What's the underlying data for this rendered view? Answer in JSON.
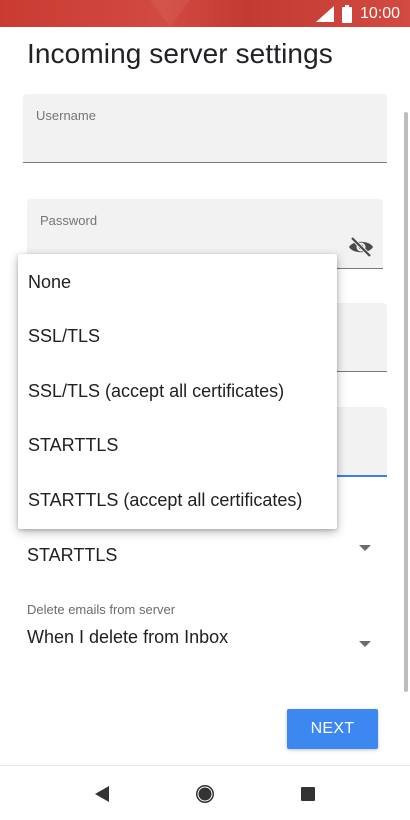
{
  "status_bar": {
    "time": "10:00",
    "icons": [
      "signal-icon",
      "battery-icon"
    ]
  },
  "page": {
    "title": "Incoming server settings"
  },
  "fields": {
    "username": {
      "label": "Username",
      "value": ""
    },
    "password": {
      "label": "Password",
      "value": ""
    }
  },
  "security_select": {
    "value": "STARTTLS"
  },
  "delete_select": {
    "caption": "Delete emails from server",
    "value": "When I delete from Inbox"
  },
  "popup_menu": {
    "options": [
      "None",
      "SSL/TLS",
      "SSL/TLS (accept all certificates)",
      "STARTTLS",
      "STARTTLS (accept all certificates)"
    ]
  },
  "actions": {
    "next_label": "NEXT"
  },
  "colors": {
    "accent": "#3d87f0",
    "status_bar": "#c93b32"
  },
  "nav_bar": {
    "icons": [
      "back-icon",
      "home-icon",
      "recents-icon"
    ]
  }
}
